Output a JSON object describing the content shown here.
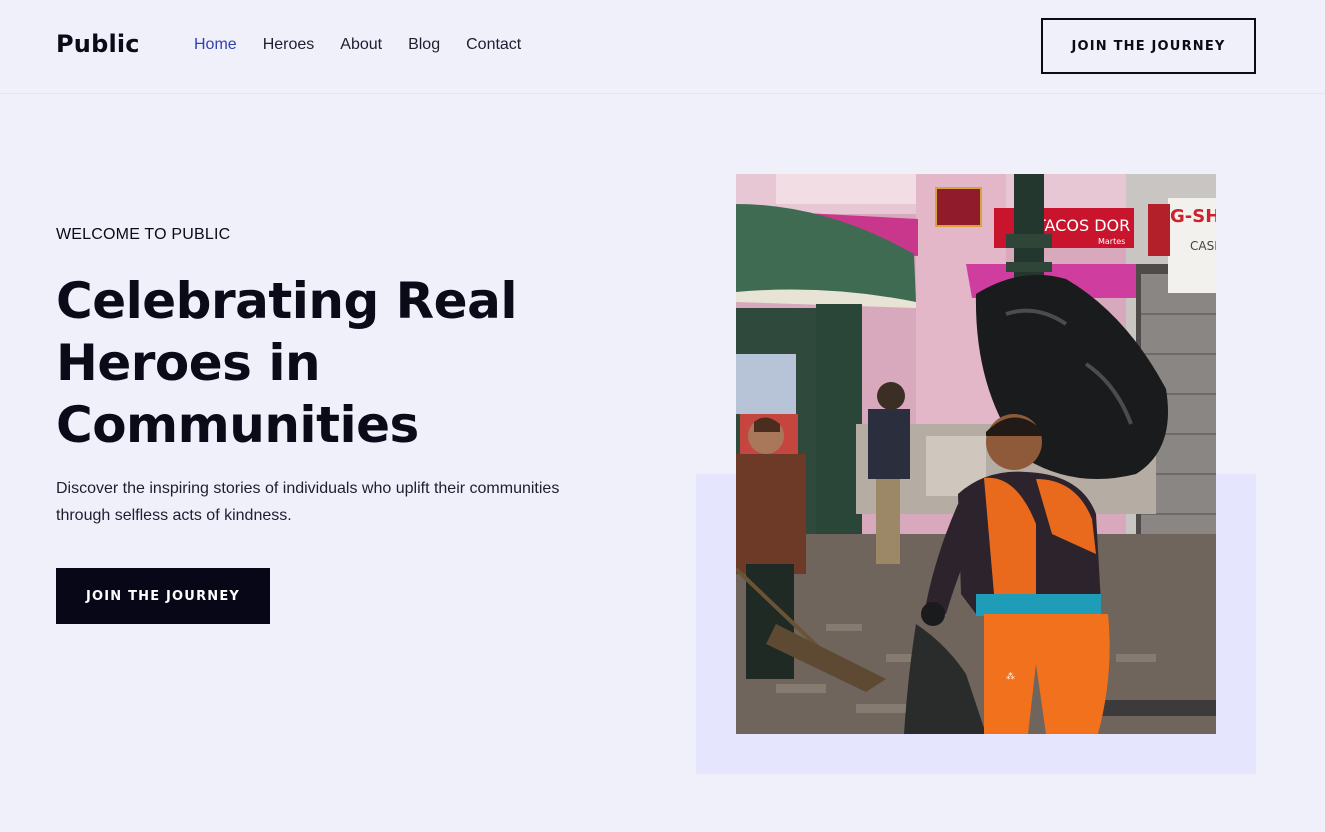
{
  "header": {
    "logo": "Public",
    "nav": [
      {
        "label": "Home",
        "active": true
      },
      {
        "label": "Heroes"
      },
      {
        "label": "About"
      },
      {
        "label": "Blog"
      },
      {
        "label": "Contact"
      }
    ],
    "cta_label": "JOIN THE JOURNEY"
  },
  "hero": {
    "eyebrow": "WELCOME TO PUBLIC",
    "headline": "Celebrating Real Heroes in Communities",
    "description": "Discover the inspiring stories of individuals who uplift their communities through selfless acts of kindness.",
    "cta_label": "JOIN THE JOURNEY",
    "image": {
      "signs": {
        "tacos": "TACOS DOR",
        "tacos_sub": "Martes",
        "g_shock": "G-SHO",
        "casio": "CASIO"
      }
    }
  },
  "colors": {
    "background": "#f0f0fb",
    "accent_box": "#e5e6fd",
    "active_link": "#3341b0",
    "button_dark": "#070718"
  }
}
